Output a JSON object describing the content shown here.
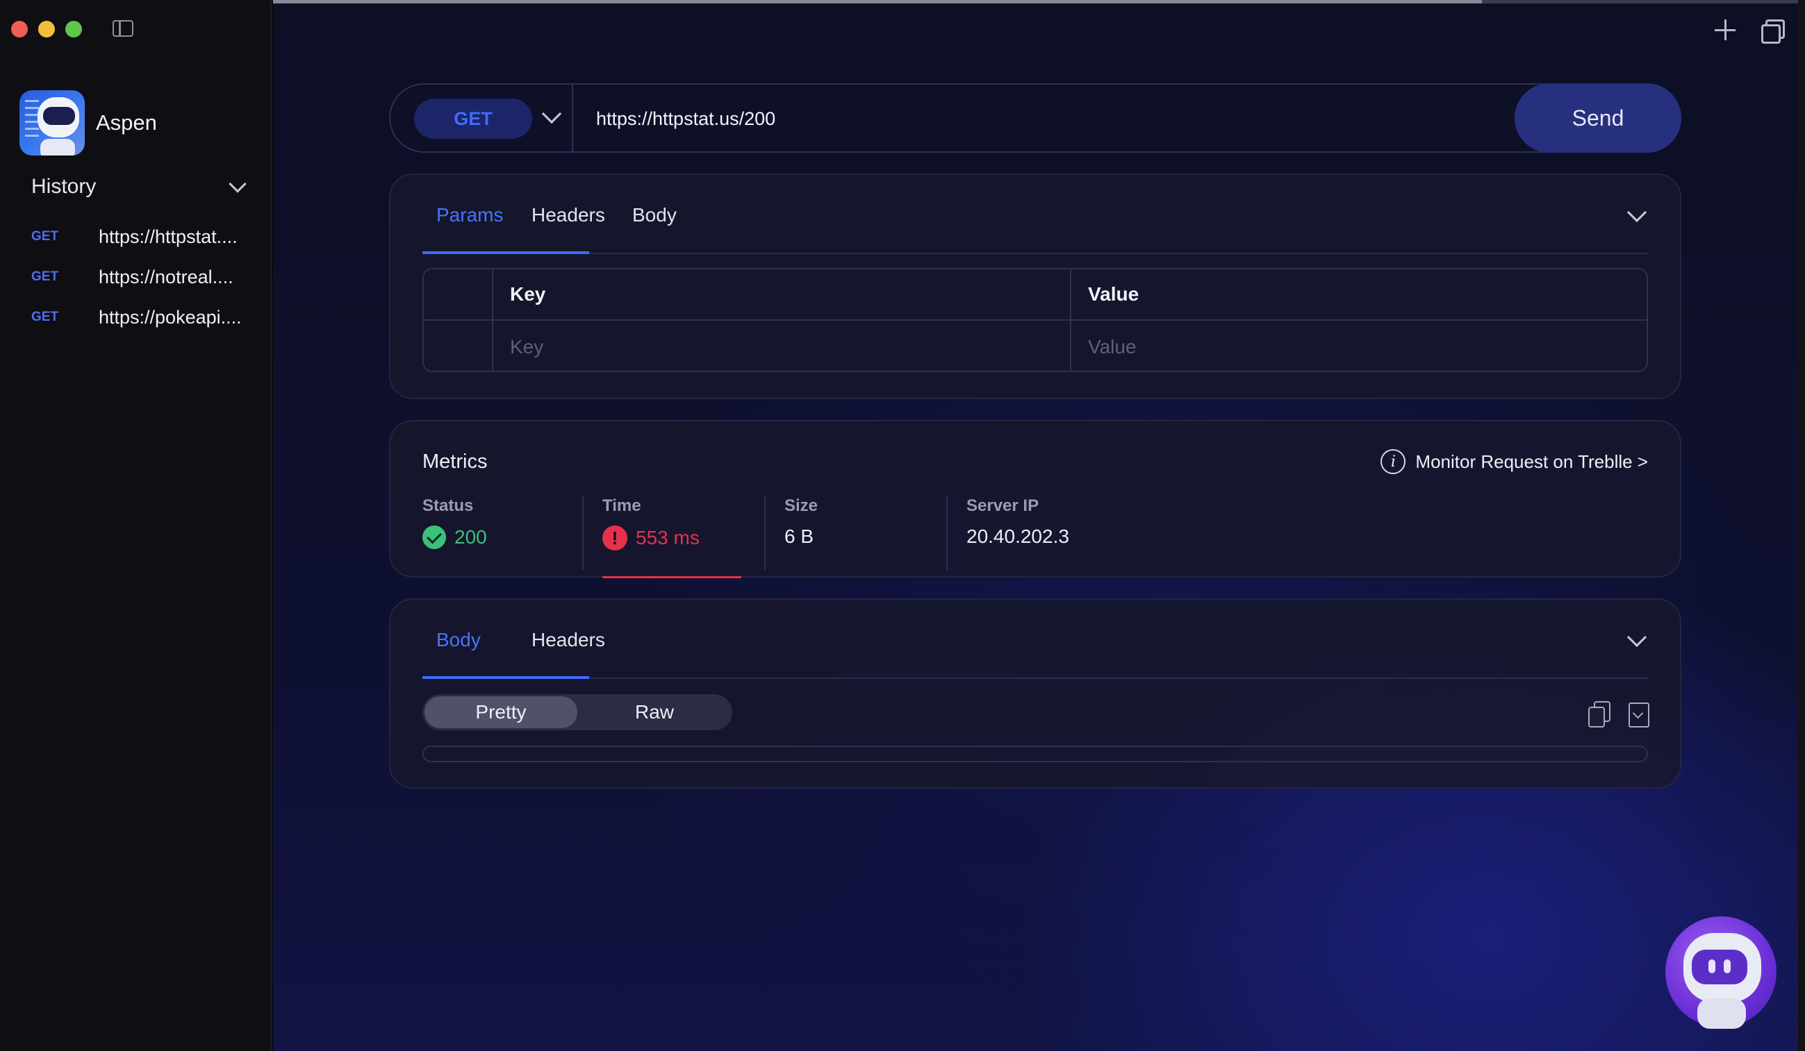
{
  "app": {
    "name": "Aspen"
  },
  "sidebar": {
    "history_title": "History",
    "items": [
      {
        "method": "GET",
        "url": "https://httpstat...."
      },
      {
        "method": "GET",
        "url": "https://notreal...."
      },
      {
        "method": "GET",
        "url": "https://pokeapi...."
      }
    ]
  },
  "request": {
    "method": "GET",
    "url": "https://httpstat.us/200",
    "send_label": "Send",
    "tabs": [
      "Params",
      "Headers",
      "Body"
    ],
    "active_tab": "Params",
    "params_table": {
      "headers": [
        "Key",
        "Value"
      ],
      "placeholders": {
        "key": "Key",
        "value": "Value"
      }
    }
  },
  "metrics": {
    "title": "Metrics",
    "monitor_link": "Monitor Request on Treblle >",
    "status": {
      "label": "Status",
      "value": "200"
    },
    "time": {
      "label": "Time",
      "value": "553 ms"
    },
    "size": {
      "label": "Size",
      "value": "6 B"
    },
    "server_ip": {
      "label": "Server IP",
      "value": "20.40.202.3"
    }
  },
  "response": {
    "tabs": [
      "Body",
      "Headers"
    ],
    "active_tab": "Body",
    "view_modes": [
      "Pretty",
      "Raw"
    ],
    "active_view": "Pretty"
  },
  "colors": {
    "accent": "#3f6bff",
    "send_button": "#27307e",
    "status_ok": "#3ac17a",
    "status_warn": "#e5324c"
  },
  "icons": {
    "window_controls": [
      "close-icon",
      "minimize-icon",
      "maximize-icon"
    ],
    "toolbar": [
      "sidebar-toggle-icon",
      "plus-icon",
      "duplicate-window-icon"
    ],
    "response": [
      "copy-icon",
      "download-icon"
    ]
  }
}
